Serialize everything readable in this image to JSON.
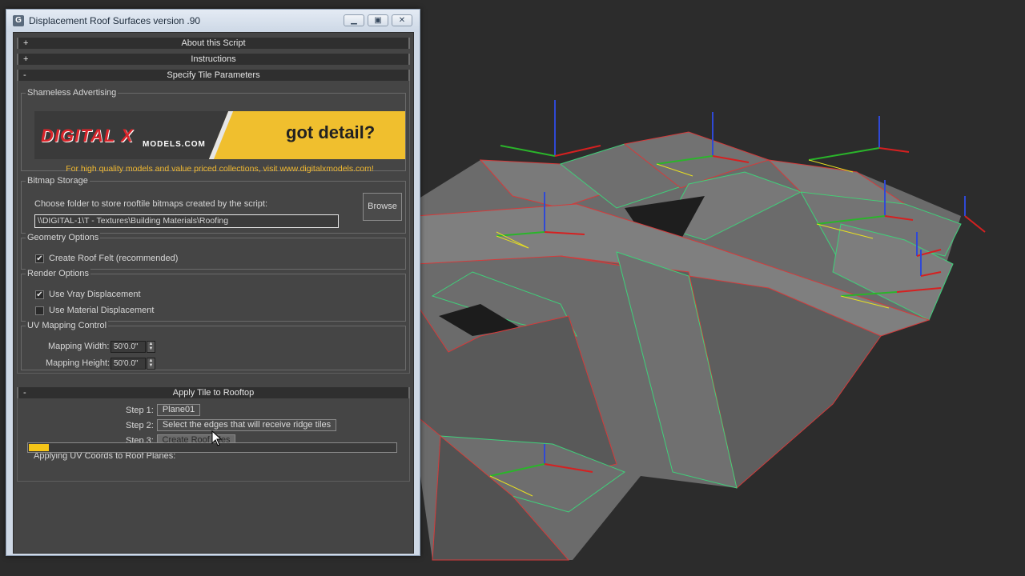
{
  "window": {
    "title": "Displacement Roof Surfaces version .90",
    "app_icon": "G"
  },
  "rollouts": {
    "about": {
      "sign": "+",
      "label": "About this Script"
    },
    "instructions": {
      "sign": "+",
      "label": "Instructions"
    },
    "specify": {
      "sign": "-",
      "label": "Specify Tile Parameters"
    },
    "apply": {
      "sign": "-",
      "label": "Apply Tile to Rooftop"
    }
  },
  "advertising": {
    "group_title": "Shameless Advertising",
    "logo": "DIGITALXMODELS.COM",
    "logo_main": "DIGITAL X",
    "logo_sub": "MODELS.COM",
    "tagline": "got detail?",
    "link_text": "For high quality models and value priced collections, visit www.digitalxmodels.com!"
  },
  "bitmap": {
    "group_title": "Bitmap Storage",
    "prompt": "Choose folder to store rooftile bitmaps created by the script:",
    "path": "\\\\DIGITAL-1\\T - Textures\\Building Materials\\Roofing",
    "browse_label": "Browse"
  },
  "geometry": {
    "group_title": "Geometry Options",
    "create_felt_label": "Create Roof Felt (recommended)",
    "create_felt_checked": true
  },
  "render": {
    "group_title": "Render Options",
    "vray_label": "Use Vray Displacement",
    "vray_checked": true,
    "material_label": "Use Material Displacement",
    "material_checked": false
  },
  "uv": {
    "group_title": "UV Mapping Control",
    "width_label": "Mapping Width:",
    "width_value": "50'0.0\"",
    "height_label": "Mapping Height:",
    "height_value": "50'0.0\""
  },
  "apply": {
    "step1_label": "Step 1:",
    "step1_value": "Plane01",
    "step2_label": "Step 2:",
    "step2_value": "Select the edges that will receive ridge tiles",
    "step3_label": "Step 3:",
    "step3_value": "Create Roof Tiles",
    "status": "Applying UV Coords to Roof Planes:",
    "progress_fraction": 0.055
  },
  "colors": {
    "progress": "#f5c518",
    "accent_yellow": "#f0bf2e",
    "edge_red": "#d63a3a",
    "edge_green": "#3fd07a"
  },
  "icons": {
    "minimize": "minimize-icon",
    "maximize": "maximize-icon",
    "close": "close-icon",
    "cursor": "mouse-pointer-icon"
  }
}
